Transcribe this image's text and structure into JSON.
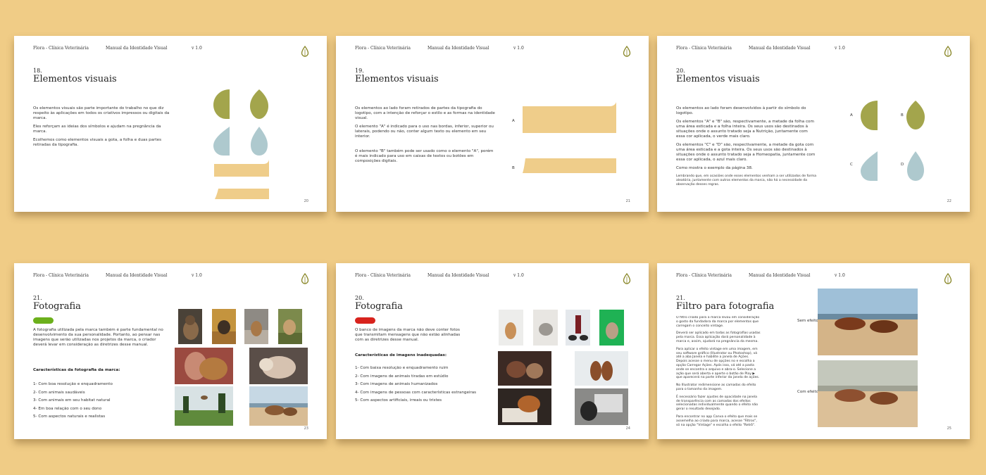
{
  "header": {
    "brand": "Flora - Clínica Veterinária",
    "manual": "Manual da Identidade Visual",
    "version": "v 1.0"
  },
  "colors": {
    "background": "#f0cc86",
    "leaf_green": "#a3a54c",
    "drop_blue": "#aec9ce",
    "sand_beige": "#efcd8a",
    "approve_green": "#6cb01c",
    "reject_red": "#d8231d"
  },
  "icons": {
    "logo": "drop-icon"
  },
  "pages": [
    {
      "number": "18.",
      "title": "Elementos visuais",
      "paragraphs": [
        "Os elementos visuais são parte importante do trabalho no que diz respeito às aplicações em todos os criativos impressos ou digitais da marca.",
        "Eles reforçam as ideias dos símbolos e ajudam na pregnância da marca.",
        "Ecolhemos como elementos visuais a gota, a folha e duas partes retiradas da tipografia."
      ],
      "page_number": "20"
    },
    {
      "number": "19.",
      "title": "Elementos visuais",
      "paragraphs": [
        "Os elementos ao lado foram retirados de partes da tipografia do logotipo, com a intenção de reforçar o estilo e as formas na identidade visual.",
        "O elemento \"A\" é indicado para o uso nas bordas, inferior, superior ou laterais, podendo ou não, conter algum texto ou elemento em seu interior.",
        "O elemento \"B\" também pode ser usado como o elemento \"A\", porém é mais indicado para uso em caixas de textos ou botões em composições digitais."
      ],
      "labels": [
        "A",
        "B"
      ],
      "page_number": "21"
    },
    {
      "number": "20.",
      "title": "Elementos visuais",
      "paragraphs": [
        "Os elementos ao lado foram desenvolvidos à partir do símbolo do logotipo.",
        "Os elementos \"A\" e \"B\" são, respectivamente, a metade da folha com uma área esticada e a folha inteira. Os seus usos são destinados à situações onde o assunto tratado seja a Nutrição, juntamente com essa cor aplicada, o verde mais claro.",
        "Os elementos \"C\" e \"D\" são, respectivamente, a metade da gota com uma área esticada e a gota inteira. Os seus usos são destinados à situações onde o assunto tratado seja a Homeopatia, juntamente com essa cor aplicada, o azul mais claro.",
        "Como mostra o exemplo da página 38."
      ],
      "note": "Lembrando que, em ocasiões onde esses elementos venham a ser utilizados de forma aleatória, juntamente com outros elementos da marca, não há a necessidade da observação desses regras.",
      "labels": [
        "A",
        "B",
        "C",
        "D"
      ],
      "page_number": "22"
    },
    {
      "number": "21.",
      "title": "Fotografia",
      "intro": "A fotografia utilizada pela marca também é parte fundamental no desenvolvimento da sua personalidade. Portanto, ao pensar nas imagens que serão utilizadas nos projetos da marca, o criador deverá levar em consideração as diretrizes desse manual.",
      "list_title": "Características da fotografia da marca:",
      "items": [
        "1- Com boa resolução e enquadramento",
        "2- Com animais saudáveis",
        "3- Com animais em seu habitat natural",
        "4- Em boa relação com o seu dono",
        "5- Com aspectos naturais e realistas"
      ],
      "page_number": "23"
    },
    {
      "number": "20.",
      "title": "Fotografia",
      "intro": "O banco de imagens da marca não deve conter fotos que transmitam mensagens que não estão alinhadas com as diretrizes desse manual.",
      "list_title": "Características de imagens inadequadas:",
      "items": [
        "1- Com baixa resolução e enquadramento ruim",
        "2- Com imagens de animais tiradas em estúdio",
        "3- Com imagens de animais humanizados",
        "4- Com imagens de pessoas com características estrangeiras",
        "5- Com aspectos artificiais, irreais ou tristes"
      ],
      "page_number": "24"
    },
    {
      "number": "21.",
      "title": "Filtro para fotografia",
      "paragraphs": [
        "O filtro criado para a marca levou em consideração o gosto da fundadora da marca por elementos que carregam o conceito vintage.",
        "Deverá ser aplicado em todas as fotografias usadas pela marca. Essa aplicação dará personalidade à marca e, assim, ajudará na pregnância da mesma.",
        "Para aplicar o efeito vintage em uma imagem, em seu software gráfico (Illustrator ou Photoshop), vá até a aba Janela e habilite a janela de Ações. Depois acesse o menu de opções no e escolha a opção Carregar Ações. Após isso, vá até a pasta onde se encontra o arquivo e abra-o. Selecione a ação que será aberta e aperte o botão de Play ▶ que aparecerá na parte inferior da janela de ações.",
        "No Illustrator redimensione as camadas do efeito para o tamanho da imagem.",
        "É necessário fazer ajustes de opacidade na janela de transparência com as camadas dos efeitos selecionadas individualmente quando o efeito não gerar o resultado desejado.",
        "Para encontrar no app Canva o efeito que mais se assemelha ao criado para marca, acesse \"Filtros\", só na opção \"Vintage\" e escolha o efeito \"Retrô\"."
      ],
      "labels": [
        "Sem efeito",
        "Com efeito"
      ],
      "page_number": "25"
    }
  ]
}
